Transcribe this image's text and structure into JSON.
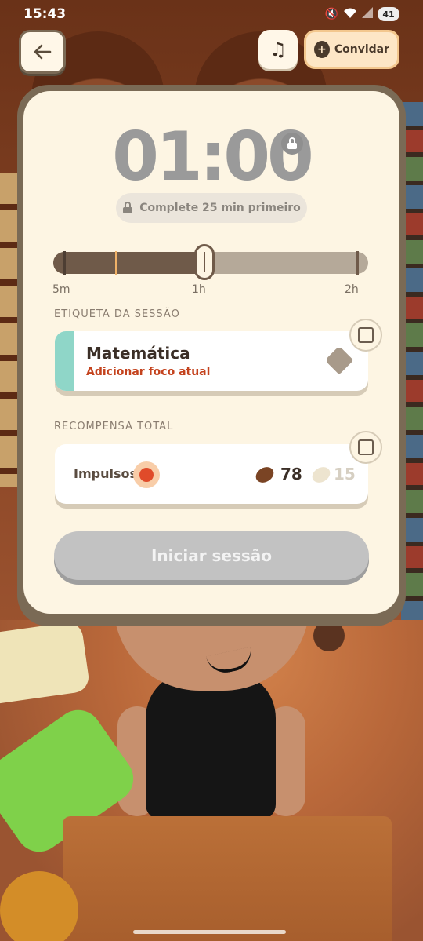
{
  "status_bar": {
    "time": "15:43",
    "battery": "41",
    "icons": [
      "mute-icon",
      "wifi-icon",
      "signal-icon",
      "battery-icon"
    ]
  },
  "header": {
    "back_icon": "arrow-left-icon",
    "music_icon": "music-note-icon",
    "invite_label": "Convidar",
    "invite_icon": "add-person-icon"
  },
  "timer": {
    "value": "01:00",
    "lock_icon": "lock-icon",
    "lock_message": "Complete 25 min primeiro"
  },
  "duration_slider": {
    "labels": [
      "5m",
      "1h",
      "2h"
    ],
    "value_fraction": 0.48,
    "marker_fraction": 0.2
  },
  "session_label": {
    "section_title": "ETIQUETA DA SESSÃO",
    "title": "Matemática",
    "subtitle": "Adicionar foco atual",
    "accent_color": "#8fd6c8",
    "tag_icon": "tag-icon",
    "edit_icon": "edit-icon"
  },
  "reward": {
    "section_title": "RECOMPENSA TOTAL",
    "label": "Impulsos",
    "badge_icon": "tomato-icon",
    "coffee_icon": "coffee-bean-icon",
    "coffee_value": "78",
    "bean_icon": "white-bean-icon",
    "bean_value": "15",
    "edit_icon": "edit-icon"
  },
  "start_button": {
    "label": "Iniciar sessão"
  }
}
